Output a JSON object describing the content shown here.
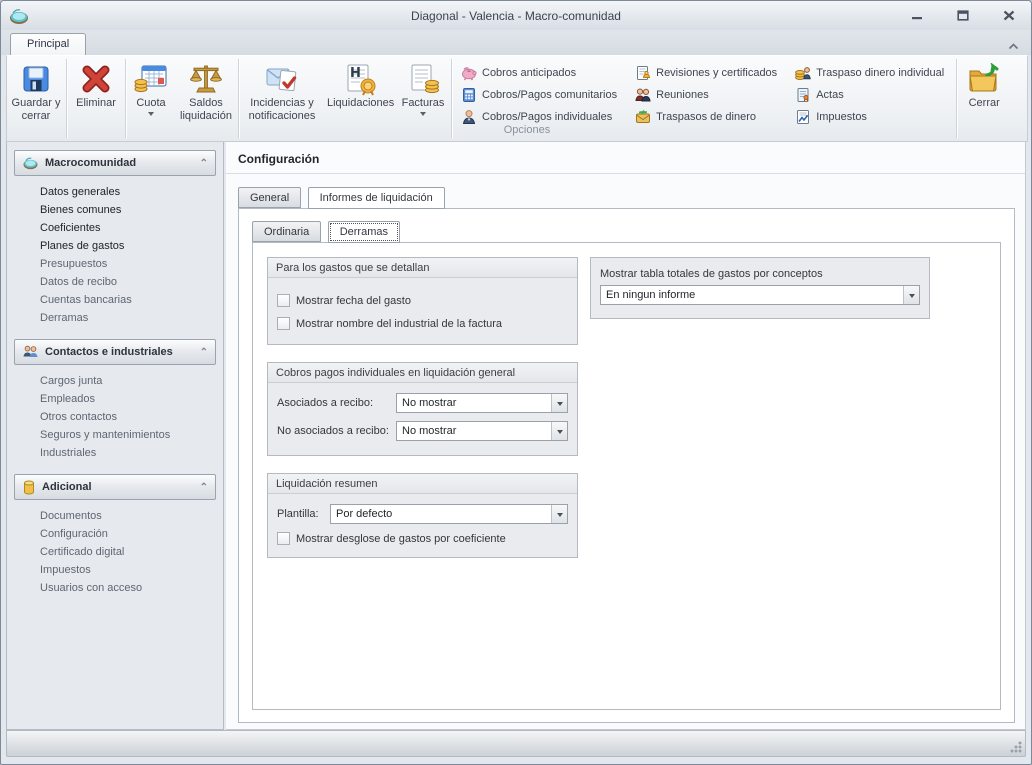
{
  "window": {
    "title": "Diagonal - Valencia - Macro-comunidad",
    "controls": {
      "minimize": "minimize",
      "restore": "restore",
      "close": "close"
    }
  },
  "ribbon": {
    "tab_label": "Principal",
    "group_label": "Opciones",
    "large_buttons": [
      {
        "label": "Guardar y cerrar",
        "icon": "save-icon",
        "dropdown": false
      },
      {
        "label": "Eliminar",
        "icon": "delete-icon",
        "dropdown": false
      },
      {
        "label": "Cuota",
        "icon": "quota-icon",
        "dropdown": true
      },
      {
        "label": "Saldos liquidación",
        "icon": "scales-icon",
        "dropdown": false
      },
      {
        "label": "Incidencias y notificaciones",
        "icon": "incidents-icon",
        "dropdown": false
      },
      {
        "label": "Liquidaciones",
        "icon": "settlements-icon",
        "dropdown": false
      },
      {
        "label": "Facturas",
        "icon": "invoices-icon",
        "dropdown": true
      }
    ],
    "small_columns": [
      [
        {
          "label": "Cobros anticipados",
          "icon": "piggy-bank-icon"
        },
        {
          "label": "Cobros/Pagos comunitarios",
          "icon": "calculator-icon"
        },
        {
          "label": "Cobros/Pagos individuales",
          "icon": "person-icon"
        }
      ],
      [
        {
          "label": "Revisiones y certificados",
          "icon": "certificate-icon"
        },
        {
          "label": "Reuniones",
          "icon": "meeting-icon"
        },
        {
          "label": "Traspasos de dinero",
          "icon": "money-transfer-icon"
        }
      ],
      [
        {
          "label": "Traspaso dinero individual",
          "icon": "individual-transfer-icon"
        },
        {
          "label": "Actas",
          "icon": "minutes-icon"
        },
        {
          "label": "Impuestos",
          "icon": "taxes-icon"
        }
      ]
    ],
    "close_button": {
      "label": "Cerrar",
      "icon": "close-folder-icon"
    }
  },
  "sidebar": {
    "sections": [
      {
        "title": "Macrocomunidad",
        "icon": "community-icon",
        "items": [
          {
            "label": "Datos generales",
            "dark": true
          },
          {
            "label": "Bienes comunes",
            "dark": true
          },
          {
            "label": "Coeficientes",
            "dark": true
          },
          {
            "label": "Planes de gastos",
            "dark": true
          },
          {
            "label": "Presupuestos",
            "dark": false
          },
          {
            "label": "Datos de recibo",
            "dark": false
          },
          {
            "label": "Cuentas bancarias",
            "dark": false
          },
          {
            "label": "Derramas",
            "dark": false
          }
        ]
      },
      {
        "title": "Contactos e industriales",
        "icon": "contacts-icon",
        "items": [
          {
            "label": "Cargos junta",
            "dark": false
          },
          {
            "label": "Empleados",
            "dark": false
          },
          {
            "label": "Otros contactos",
            "dark": false
          },
          {
            "label": "Seguros y mantenimientos",
            "dark": false
          },
          {
            "label": "Industriales",
            "dark": false
          }
        ]
      },
      {
        "title": "Adicional",
        "icon": "database-icon",
        "items": [
          {
            "label": "Documentos",
            "dark": false
          },
          {
            "label": "Configuración",
            "dark": false
          },
          {
            "label": "Certificado digital",
            "dark": false
          },
          {
            "label": "Impuestos",
            "dark": false
          },
          {
            "label": "Usuarios con acceso",
            "dark": false
          }
        ]
      }
    ]
  },
  "main": {
    "title": "Configuración",
    "tabs": [
      {
        "label": "General",
        "active": false
      },
      {
        "label": "Informes de liquidación",
        "active": true
      }
    ],
    "subtabs": [
      {
        "label": "Ordinaria",
        "active": false
      },
      {
        "label": "Derramas",
        "active": true
      }
    ],
    "group_detail": {
      "title": "Para los gastos que se detallan",
      "checkboxes": [
        {
          "label": "Mostrar fecha del gasto",
          "checked": false
        },
        {
          "label": "Mostrar nombre del industrial de la factura",
          "checked": false
        }
      ]
    },
    "group_individual": {
      "title": "Cobros pagos individuales en liquidación general",
      "rows": [
        {
          "label": "Asociados a recibo:",
          "value": "No mostrar"
        },
        {
          "label": "No asociados a recibo:",
          "value": "No mostrar"
        }
      ]
    },
    "group_summary": {
      "title": "Liquidación resumen",
      "template_label": "Plantilla:",
      "template_value": "Por defecto",
      "checkbox": {
        "label": "Mostrar desglose de gastos por coeficiente",
        "checked": false
      }
    },
    "right_group": {
      "label": "Mostrar tabla totales de gastos por conceptos",
      "value": "En ningun informe"
    }
  },
  "colors": {
    "accent_blue": "#3d7edb",
    "delete_red": "#c23b2e",
    "gold": "#d8a33c",
    "folder_yellow": "#f0c04a",
    "arrow_green": "#3fae49"
  }
}
